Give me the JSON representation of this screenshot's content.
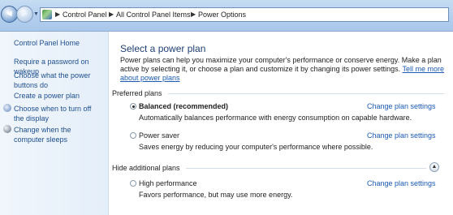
{
  "breadcrumb": {
    "items": [
      "Control Panel",
      "All Control Panel Items",
      "Power Options"
    ],
    "separator": "▶"
  },
  "nav": {
    "back_icon": "back-arrow-icon",
    "forward_icon": "forward-arrow-icon",
    "recent_icon": "chevron-down-icon"
  },
  "sidebar": {
    "home": "Control Panel Home",
    "links": [
      {
        "label": "Require a password on wakeup",
        "icon": null
      },
      {
        "label": "Choose what the power buttons do",
        "icon": null
      },
      {
        "label": "Create a power plan",
        "icon": null
      },
      {
        "label": "Choose when to turn off the display",
        "icon": "monitor-shield-icon"
      },
      {
        "label": "Change when the computer sleeps",
        "icon": "moon-sleep-icon"
      }
    ]
  },
  "main": {
    "title": "Select a power plan",
    "intro": "Power plans can help you maximize your computer's performance or conserve energy. Make a plan active by selecting it, or choose a plan and customize it by changing its power settings.",
    "intro_link": "Tell me more about power plans",
    "preferred_label": "Preferred plans",
    "hide_label": "Hide additional plans",
    "change_label": "Change plan settings",
    "plans": [
      {
        "name": "Balanced (recommended)",
        "desc": "Automatically balances performance with energy consumption on capable hardware.",
        "selected": true
      },
      {
        "name": "Power saver",
        "desc": "Saves energy by reducing your computer's performance where possible.",
        "selected": false
      },
      {
        "name": "High performance",
        "desc": "Favors performance, but may use more energy.",
        "selected": false
      }
    ]
  },
  "colors": {
    "accent": "#1e3f74",
    "link": "#1a5ab3",
    "sidebar_link": "#1e4f8f"
  }
}
